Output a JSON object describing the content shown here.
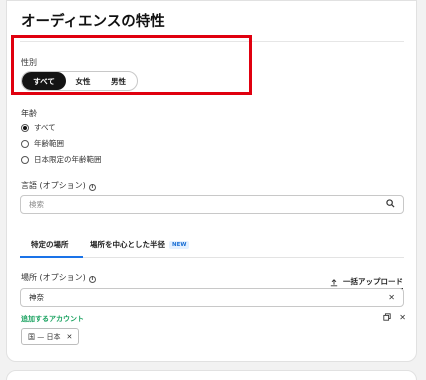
{
  "panel": {
    "title": "オーディエンスの特性"
  },
  "gender": {
    "label": "性別",
    "options": [
      "すべて",
      "女性",
      "男性"
    ],
    "selected": "すべて"
  },
  "age": {
    "label": "年齢",
    "options": [
      "すべて",
      "年齢範囲",
      "日本限定の年齢範囲"
    ],
    "selected": "すべて"
  },
  "language": {
    "label": "言語 (オプション)",
    "placeholder": "検索"
  },
  "tabs": {
    "items": [
      "特定の場所",
      "場所を中心とした半径"
    ],
    "new_badge": "NEW",
    "active": "特定の場所"
  },
  "location": {
    "label": "場所 (オプション)",
    "bulk_upload": "一括アップロード",
    "value": "神奈",
    "added_label": "追加するアカウント",
    "chip": "国 — 日本"
  }
}
